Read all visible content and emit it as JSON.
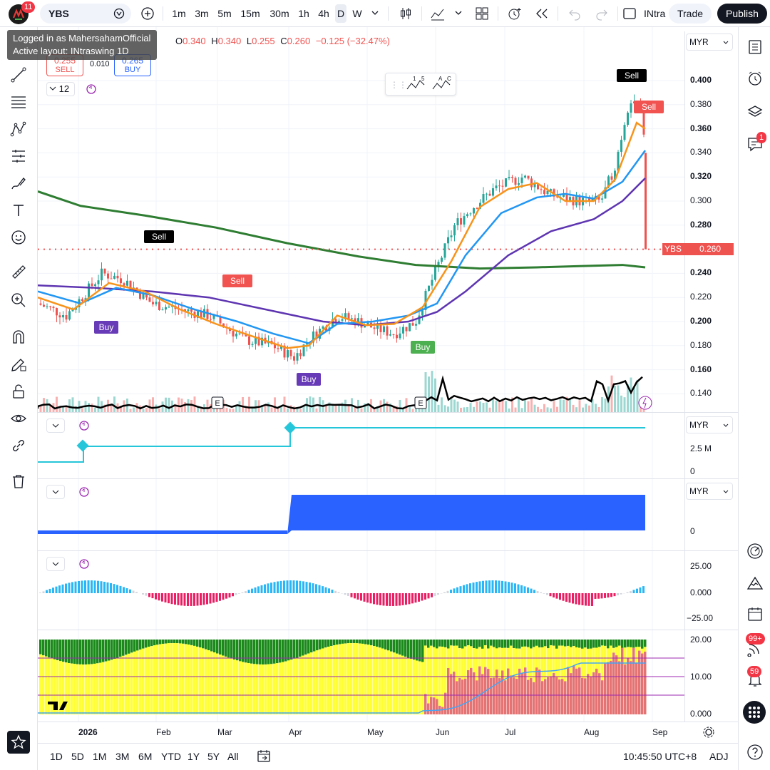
{
  "topbar": {
    "logo_badge": "11",
    "symbol": "YBS",
    "intervals": [
      "1m",
      "3m",
      "5m",
      "15m",
      "30m",
      "1h",
      "4h",
      "D",
      "W"
    ],
    "active_interval": "D",
    "layout_name": "INtra",
    "trade_label": "Trade",
    "publish_label": "Publish"
  },
  "tooltip": {
    "line1": "Logged in as MahersahamOfficial",
    "line2": "Active layout: INtraswing 1D"
  },
  "legend": {
    "o_label": "O",
    "o": "0.340",
    "h_label": "H",
    "h": "0.340",
    "l_label": "L",
    "l": "0.255",
    "c_label": "C",
    "c": "0.260",
    "change": "−0.125 (−32.47%)",
    "sell_price": "0.255",
    "sell_label": "SELL",
    "spread": "0.010",
    "buy_price": "0.265",
    "buy_label": "BUY",
    "indicator_count": "12"
  },
  "price_axis": {
    "currency": "MYR",
    "ticks": [
      "0.400",
      "0.380",
      "0.360",
      "0.340",
      "0.320",
      "0.300",
      "0.280",
      "0.260",
      "0.240",
      "0.220",
      "0.200",
      "0.180",
      "0.160",
      "0.140"
    ],
    "current_label": "YBS",
    "current_value": "0.260"
  },
  "panes": {
    "pane2": {
      "currency": "MYR",
      "ticks": [
        "2.5 M",
        "0"
      ]
    },
    "pane3": {
      "currency": "MYR",
      "ticks": [
        "0"
      ]
    },
    "pane4": {
      "ticks": [
        "25.00",
        "0.000",
        "−25.00"
      ]
    },
    "pane5": {
      "ticks": [
        "20.00",
        "10.00",
        "0.000"
      ]
    }
  },
  "signals": {
    "sell": "Sell",
    "buy": "Buy",
    "earnings": "E"
  },
  "time_axis": [
    "2026",
    "Feb",
    "Mar",
    "Apr",
    "May",
    "Jun",
    "Jul",
    "Aug",
    "Sep"
  ],
  "bottombar": {
    "ranges": [
      "1D",
      "5D",
      "1M",
      "3M",
      "6M",
      "YTD",
      "1Y",
      "5Y",
      "All"
    ],
    "clock": "10:45:50 UTC+8",
    "adj": "ADJ"
  },
  "right_badges": {
    "chat": "1",
    "streams": "99+",
    "notifications": "59"
  },
  "colors": {
    "up": "#26a69a",
    "down": "#ef5350",
    "accent": "#2962ff",
    "ma_green": "#2e7d32",
    "ma_purple": "#5e35b1",
    "ma_blue": "#2196f3",
    "ma_orange": "#f7931a",
    "buy_green": "#4caf50",
    "buy_purple": "#673ab7",
    "sell_red": "#f05350"
  }
}
